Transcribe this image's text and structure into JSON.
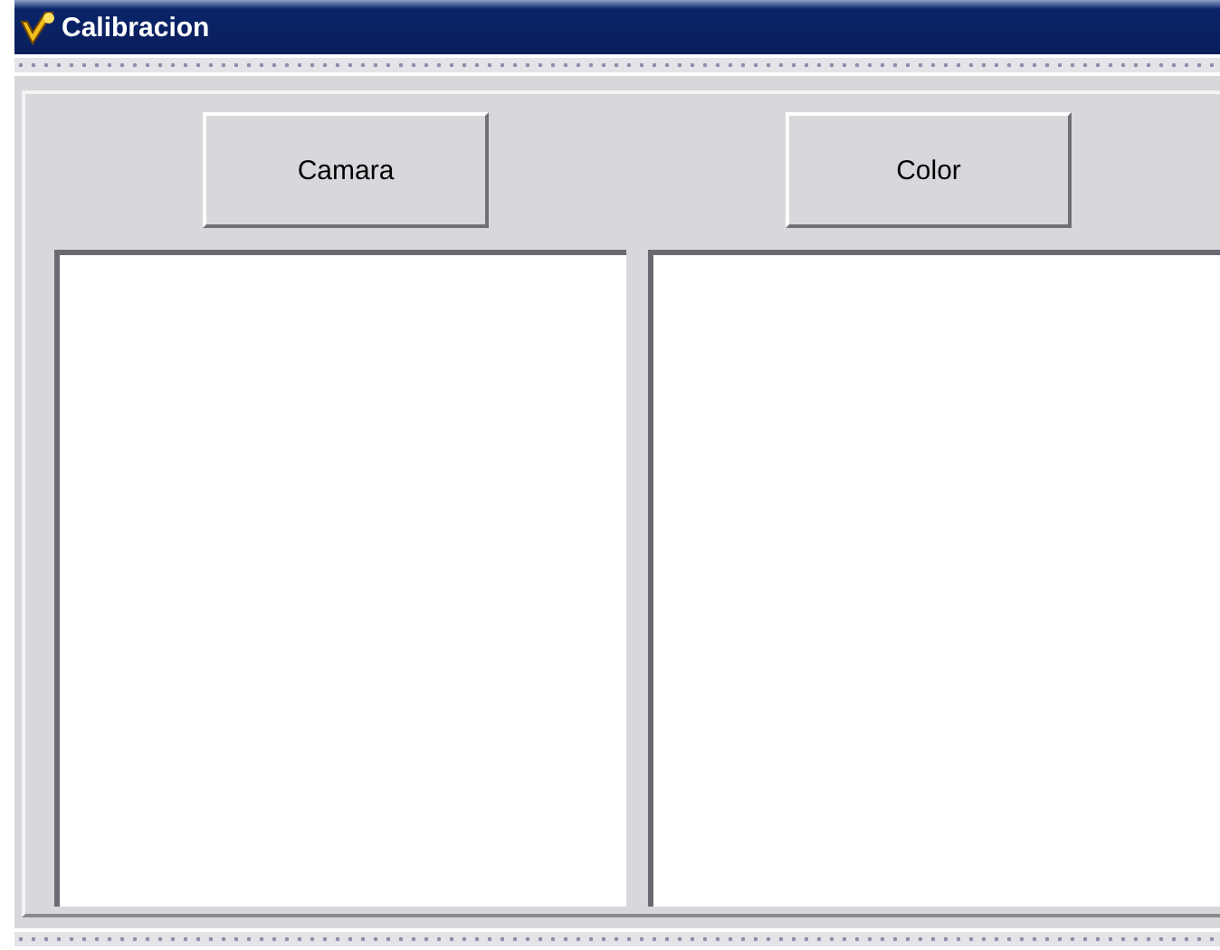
{
  "window": {
    "title": "Calibracion"
  },
  "buttons": [
    {
      "label": "Camara"
    },
    {
      "label": "Color"
    }
  ],
  "panels": [
    {
      "kind": "blank"
    },
    {
      "kind": "blank"
    }
  ]
}
